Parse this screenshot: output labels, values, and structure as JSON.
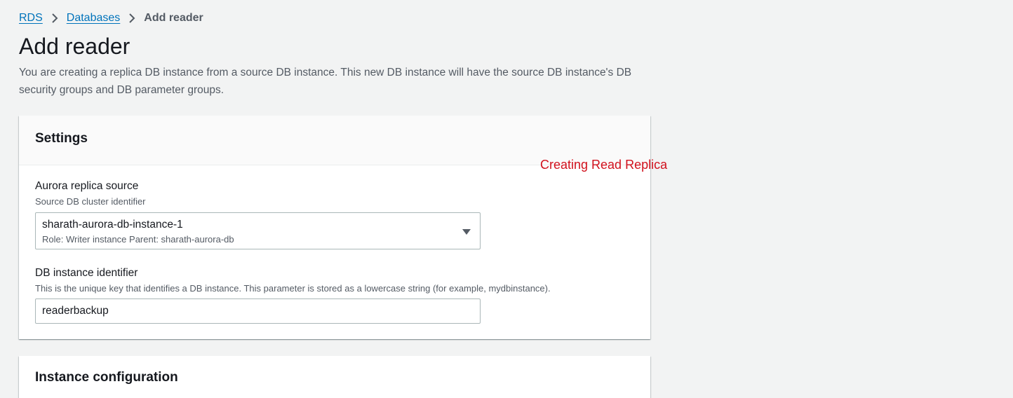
{
  "breadcrumb": {
    "items": [
      {
        "label": "RDS"
      },
      {
        "label": "Databases"
      },
      {
        "label": "Add reader"
      }
    ]
  },
  "page": {
    "title": "Add reader",
    "description": "You are creating a replica DB instance from a source DB instance. This new DB instance will have the source DB instance's DB security groups and DB parameter groups."
  },
  "settings": {
    "title": "Settings",
    "replica_source": {
      "label": "Aurora replica source",
      "description": "Source DB cluster identifier",
      "selected_value": "sharath-aurora-db-instance-1",
      "selected_detail": "Role: Writer instance Parent: sharath-aurora-db"
    },
    "db_instance_identifier": {
      "label": "DB instance identifier",
      "description": "This is the unique key that identifies a DB instance. This parameter is stored as a lowercase string (for example, mydbinstance).",
      "value": "readerbackup"
    }
  },
  "annotation": {
    "text": "Creating Read Replica",
    "color": "#d1111d"
  },
  "instance_configuration": {
    "title": "Instance configuration"
  },
  "colors": {
    "link": "#0073bb",
    "background": "#f2f3f3",
    "panel": "#ffffff",
    "panel_header": "#fafafa"
  },
  "icons": {
    "breadcrumb_separator": "chevron-right-icon",
    "select_caret": "caret-down-icon"
  }
}
